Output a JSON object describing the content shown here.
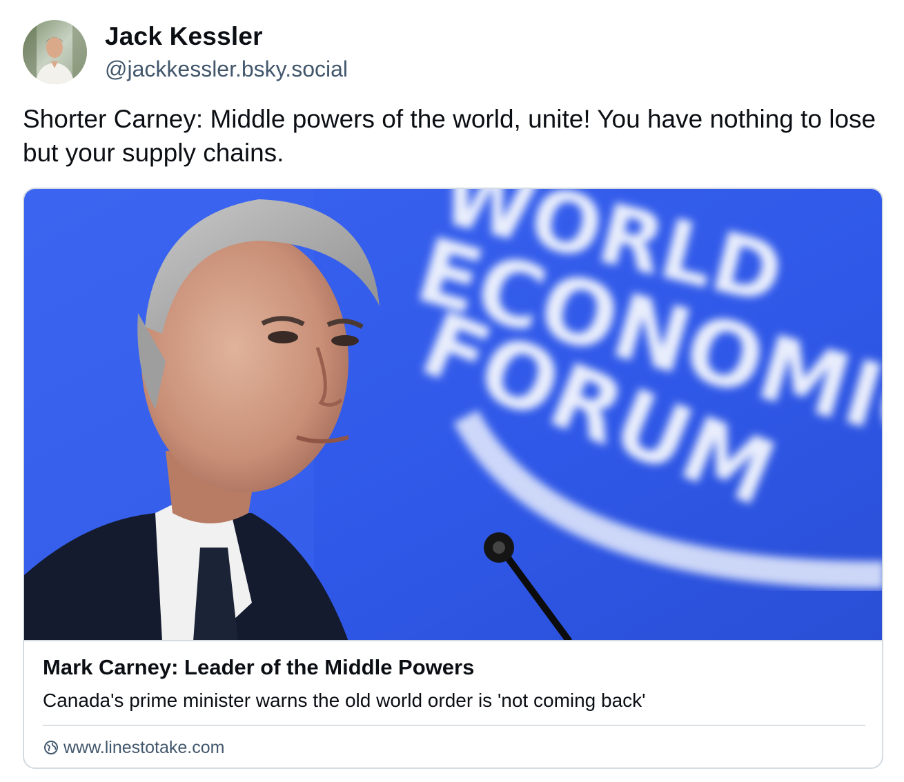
{
  "post": {
    "author": {
      "display_name": "Jack Kessler",
      "handle": "@jackkessler.bsky.social"
    },
    "text": "Shorter Carney: Middle powers of the world, unite! You have nothing to lose but your supply chains.",
    "embed": {
      "image_sign_lines": [
        "WORLD",
        "ECONOMIC",
        "FORUM"
      ],
      "title": "Mark Carney: Leader of the Middle Powers",
      "description": "Canada's prime minister warns the old world order is 'not coming back'",
      "domain": "www.linestotake.com",
      "domain_icon": "globe-icon"
    }
  },
  "colors": {
    "text_primary": "#0b0f14",
    "text_secondary": "#42576c",
    "border": "#d4dbe2",
    "image_backdrop_blue": "#2f58e8"
  }
}
